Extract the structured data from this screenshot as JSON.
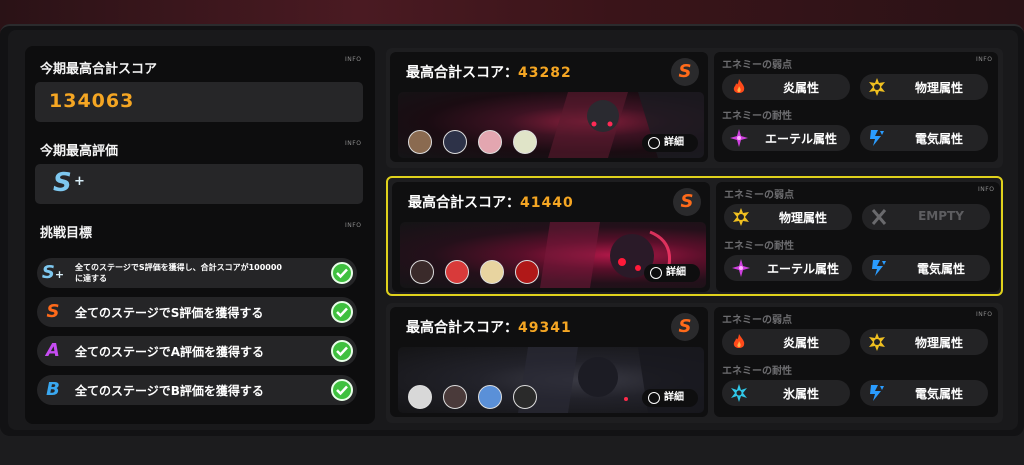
{
  "left_panel": {
    "season_score_title": "今期最高合計スコア",
    "season_score_value": "134063",
    "season_rank_title": "今期最高評価",
    "season_rank_letter": "S",
    "season_rank_plus": "+",
    "goals_title": "挑戦目標",
    "info_label": "INFO",
    "goals": [
      {
        "badge": "S",
        "badge_sup": "+",
        "text_line1": "全てのステージでS評価を獲得し、合計スコアが100000",
        "text_line2": "に達する",
        "done": true
      },
      {
        "badge": "S",
        "text": "全てのステージでS評価を獲得する",
        "done": true
      },
      {
        "badge": "A",
        "text": "全てのステージでA評価を獲得する",
        "done": true
      },
      {
        "badge": "B",
        "text": "全てのステージでB評価を獲得する",
        "done": true
      }
    ]
  },
  "stages": [
    {
      "score_label": "最高合計スコア：",
      "score_value": "43282",
      "rank": "S",
      "detail_label": "詳細",
      "weak_title": "エネミーの弱点",
      "resist_title": "エネミーの耐性",
      "info_label": "INFO",
      "weaknesses": [
        {
          "icon": "fire-icon",
          "label": "炎属性"
        },
        {
          "icon": "physical-icon",
          "label": "物理属性"
        }
      ],
      "resistances": [
        {
          "icon": "ether-icon",
          "label": "エーテル属性"
        },
        {
          "icon": "electric-icon",
          "label": "電気属性"
        }
      ]
    },
    {
      "score_label": "最高合計スコア：",
      "score_value": "41440",
      "rank": "S",
      "detail_label": "詳細",
      "weak_title": "エネミーの弱点",
      "resist_title": "エネミーの耐性",
      "info_label": "INFO",
      "weaknesses": [
        {
          "icon": "physical-icon",
          "label": "物理属性"
        },
        {
          "icon": "empty-icon",
          "label": "EMPTY"
        }
      ],
      "resistances": [
        {
          "icon": "ether-icon",
          "label": "エーテル属性"
        },
        {
          "icon": "electric-icon",
          "label": "電気属性"
        }
      ]
    },
    {
      "score_label": "最高合計スコア：",
      "score_value": "49341",
      "rank": "S",
      "detail_label": "詳細",
      "weak_title": "エネミーの弱点",
      "resist_title": "エネミーの耐性",
      "info_label": "INFO",
      "weaknesses": [
        {
          "icon": "fire-icon",
          "label": "炎属性"
        },
        {
          "icon": "physical-icon",
          "label": "物理属性"
        }
      ],
      "resistances": [
        {
          "icon": "ice-icon",
          "label": "氷属性"
        },
        {
          "icon": "electric-icon",
          "label": "電気属性"
        }
      ]
    }
  ],
  "colors": {
    "accent_orange": "#f5a623",
    "selected_border": "#e0d21c",
    "check_green": "#3fc03f"
  }
}
